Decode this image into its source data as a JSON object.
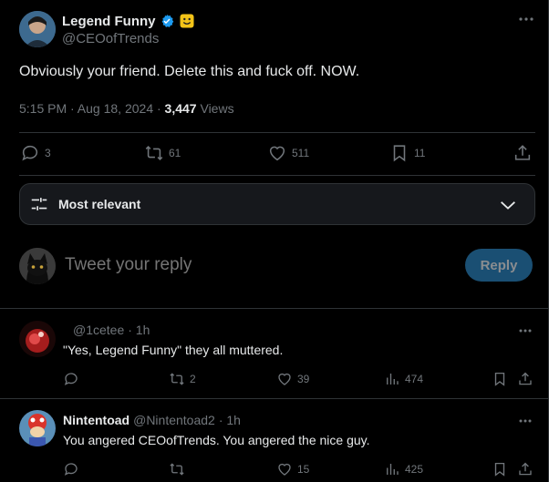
{
  "tweet": {
    "author_name": "Legend Funny",
    "author_handle": "@CEOofTrends",
    "text": "Obviously your friend. Delete this and fuck off. NOW.",
    "time": "5:15 PM · Aug 18, 2024 · ",
    "views_count": "3,447",
    "views_label": " Views",
    "replies": "3",
    "reposts": "61",
    "likes": "511",
    "bookmarks": "11"
  },
  "sort": {
    "label": "Most relevant"
  },
  "composer": {
    "placeholder": "Tweet your reply",
    "button": "Reply"
  },
  "replies": [
    {
      "name": "",
      "handle": "@1cetee",
      "time": "· 1h",
      "text": "\"Yes, Legend Funny\" they all muttered.",
      "replies": "",
      "reposts": "2",
      "likes": "39",
      "views": "474"
    },
    {
      "name": "Nintentoad",
      "handle": "@Nintentoad2",
      "time": "· 1h",
      "text": "You angered CEOofTrends. You angered the nice guy.",
      "replies": "",
      "reposts": "",
      "likes": "15",
      "views": "425"
    }
  ],
  "colors": {
    "accent": "#1d9bf0",
    "muted": "#71767b",
    "border": "#2f3336",
    "reply_button": "#1a4f73"
  },
  "icons": [
    "verified-badge-icon",
    "smiley-emoji-icon",
    "more-icon",
    "reply-icon",
    "repost-icon",
    "like-icon",
    "bookmark-icon",
    "share-icon",
    "sort-icon",
    "chevron-down-icon",
    "views-icon"
  ]
}
